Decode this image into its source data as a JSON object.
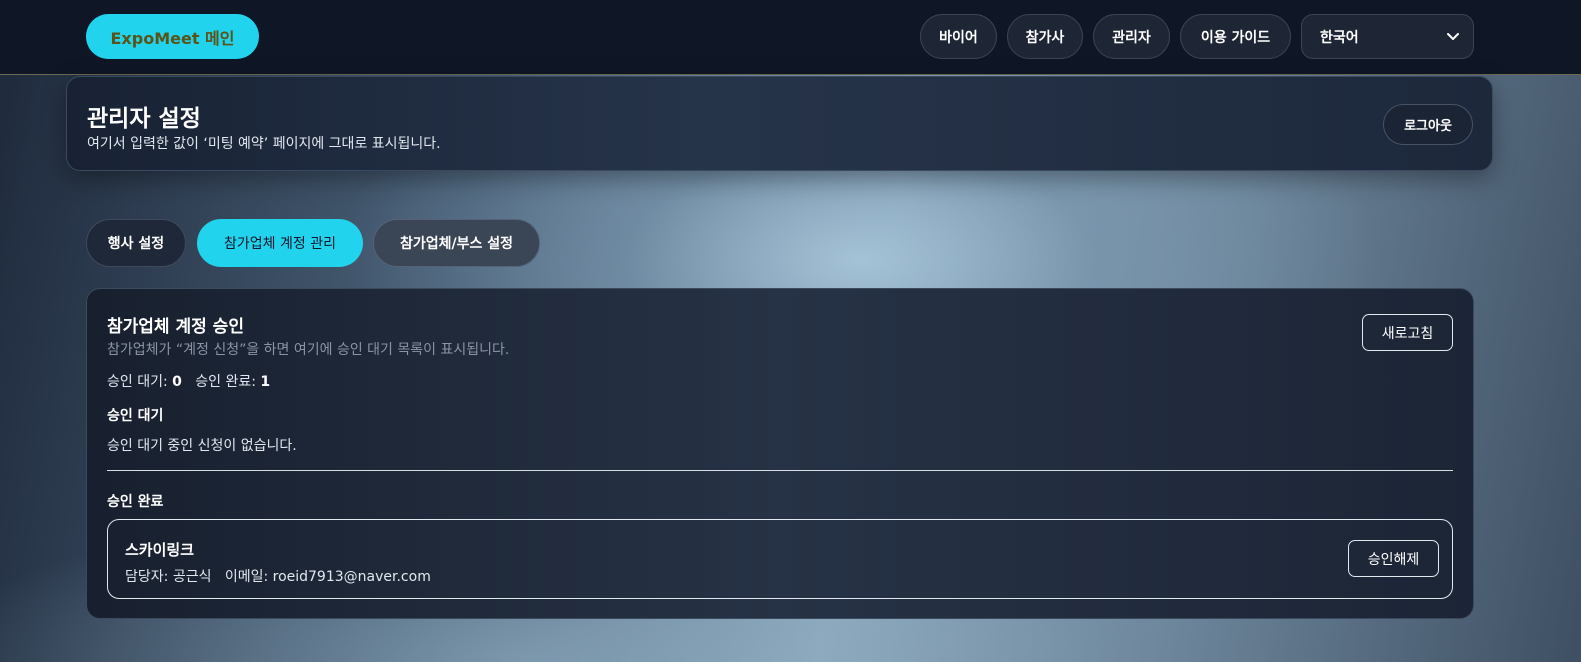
{
  "topbar": {
    "brand_label": "ExpoMeet 메인",
    "nav": [
      "바이어",
      "참가사",
      "관리자",
      "이용 가이드"
    ],
    "language": {
      "selected": "한국어"
    }
  },
  "header": {
    "title": "관리자 설정",
    "subtitle": "여기서 입력한 값이 ‘미팅 예약’ 페이지에 그대로 표시됩니다.",
    "logout_label": "로그아웃"
  },
  "tabs": [
    {
      "label": "행사 설정",
      "active": false
    },
    {
      "label": "참가업체 계정 관리",
      "active": true
    },
    {
      "label": "참가업체/부스 설정",
      "active": false
    }
  ],
  "panel": {
    "title": "참가업체 계정 승인",
    "subtitle": "참가업체가 “계정 신청”을 하면 여기에 승인 대기 목록이 표시됩니다.",
    "refresh_label": "새로고침",
    "stats": {
      "pending_label": "승인 대기:",
      "pending_count": "0",
      "approved_label": "승인 완료:",
      "approved_count": "1"
    },
    "pending": {
      "heading": "승인 대기",
      "empty_text": "승인 대기 중인 신청이 없습니다."
    },
    "approved": {
      "heading": "승인 완료",
      "items": [
        {
          "name": "스카이링크",
          "contact_label": "담당자:",
          "contact": "공근식",
          "email_label": "이메일:",
          "email": "roeid7913@naver.com",
          "action_label": "승인해제"
        }
      ]
    }
  },
  "colors": {
    "accent": "#22d3ee",
    "topbar_bg": "#0f1626",
    "card_bg": "#1e293b"
  }
}
